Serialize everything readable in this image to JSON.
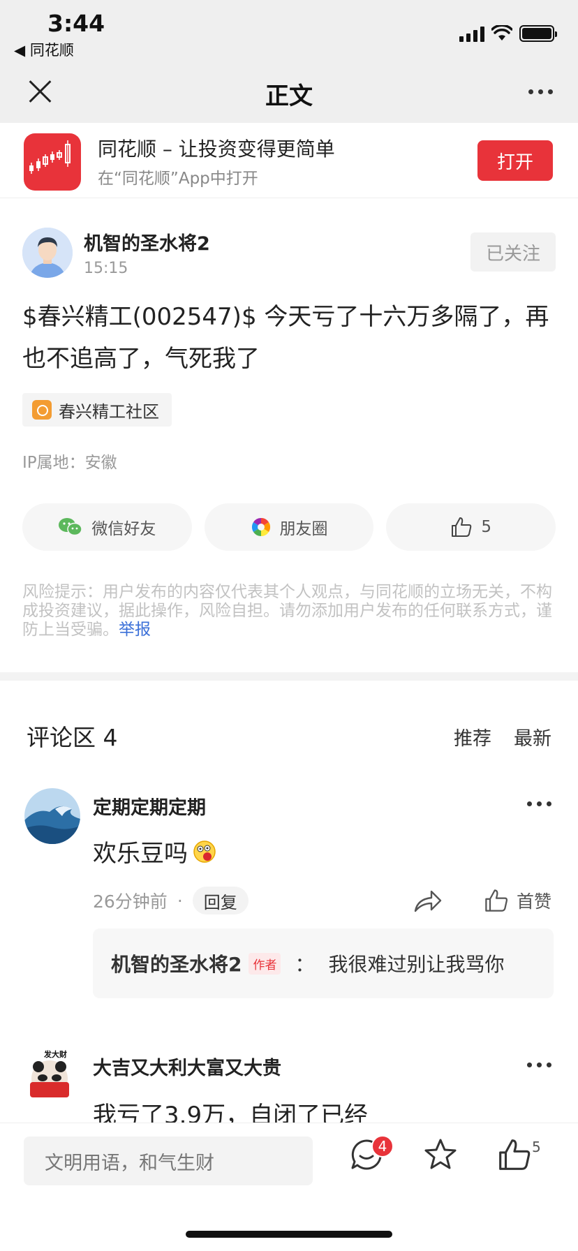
{
  "status_bar": {
    "time": "3:44",
    "back_app": "◀ 同花顺"
  },
  "nav": {
    "title": "正文"
  },
  "banner": {
    "title": "同花顺 – 让投资变得更简单",
    "subtitle": "在“同花顺”App中打开",
    "open_label": "打开"
  },
  "post": {
    "author": "机智的圣水将2",
    "time": "15:15",
    "follow_label": "已关注",
    "text": "$春兴精工(002547)$ 今天亏了十六万多隔了，再也不追高了，气死我了",
    "community_tag": "春兴精工社区",
    "ip_location": "IP属地：安徽",
    "share_wechat": "微信好友",
    "share_moments": "朋友圈",
    "likes": "5",
    "risk_notice": "风险提示：用户发布的内容仅代表其个人观点，与同花顺的立场无关，不构成投资建议，据此操作，风险自担。请勿添加用户发布的任何联系方式，谨防上当受骗。",
    "report_label": "举报"
  },
  "comments_section": {
    "title": "评论区 4",
    "sort_recommend": "推荐",
    "sort_latest": "最新"
  },
  "comments": [
    {
      "user": "定期定期定期",
      "text": "欢乐豆吗",
      "time": "26分钟前",
      "dot": "·",
      "reply_label": "回复",
      "like_label": "首赞",
      "reply": {
        "user": "机智的圣水将2",
        "badge": "作者",
        "sep": "：",
        "text": "我很难过别让我骂你"
      }
    },
    {
      "user": "大吉又大利大富又大贵",
      "text": "我亏了3.9万，自闭了已经",
      "avatar_text": "发大财"
    }
  ],
  "bottom_bar": {
    "input_placeholder": "文明用语，和气生财",
    "comment_badge": "4",
    "like_count": "5"
  }
}
